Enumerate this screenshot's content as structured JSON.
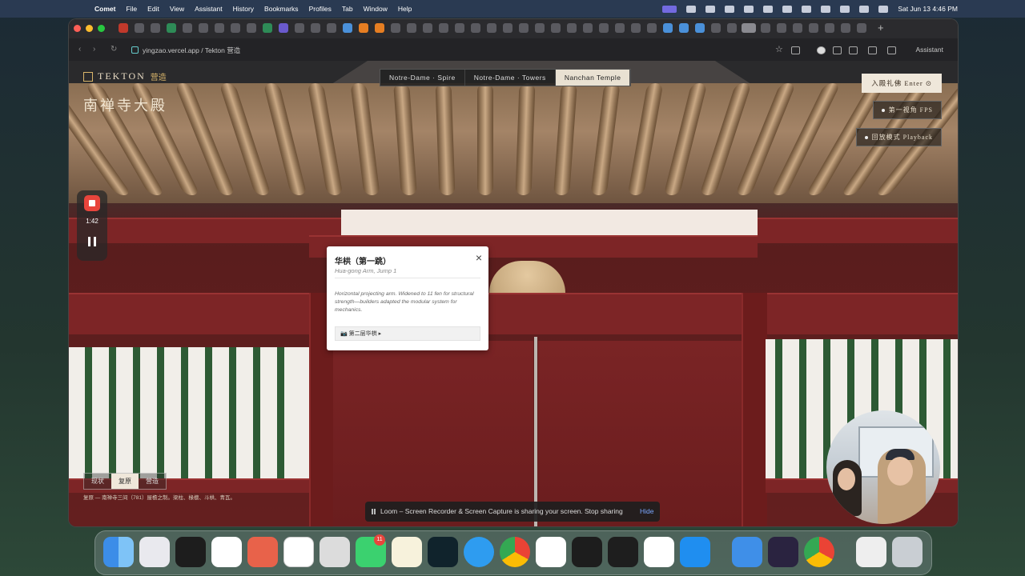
{
  "menubar": {
    "app": "Comet",
    "menus": [
      "File",
      "Edit",
      "View",
      "Assistant",
      "History",
      "Bookmarks",
      "Profiles",
      "Tab",
      "Window",
      "Help"
    ],
    "clock": "Sat Jun 13  4:46 PM"
  },
  "browser": {
    "url": "yingzao.vercel.app / Tekton 营造",
    "assistant_label": "Assistant"
  },
  "page": {
    "brand": "TEKTON",
    "brand_cn": "营造",
    "title": "南禅寺大殿",
    "tabs": [
      "Notre-Dame · Spire",
      "Notre-Dame · Towers",
      "Nanchan Temple"
    ],
    "active_tab": "Nanchan Temple",
    "enter_button": "入殿礼佛 Enter ⊙",
    "modes": [
      "第一视角 FPS",
      "回放模式 Playback"
    ],
    "mode_switch": [
      "现状",
      "复原",
      "营造"
    ],
    "mode_switch_active": "复原",
    "caption": "复原 — 南禅寺三间（781）屋檐之制。梁柱、椽檩、斗栱、青瓦。"
  },
  "popup": {
    "title": "华栱（第一跳）",
    "subtitle": "Hua-gong Arm, Jump 1",
    "description": "Horizontal projecting arm. Widened to 11 fen for structural strength—builders adapted the modular system for mechanics.",
    "link": "📷 第二层华栱 ▸",
    "close": "×"
  },
  "recorder": {
    "time": "1:42"
  },
  "share_bar": {
    "message": "Loom – Screen Recorder & Screen Capture is sharing your screen.",
    "stop": "Stop sharing",
    "hide": "Hide"
  },
  "dock": {
    "messages_badge": "11"
  }
}
